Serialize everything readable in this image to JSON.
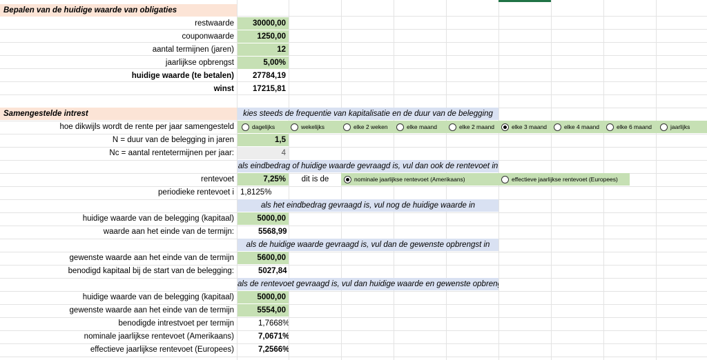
{
  "section1": {
    "title": "Bepalen van de huidige waarde van obligaties",
    "rows": [
      {
        "label": "restwaarde",
        "value": "30000,00"
      },
      {
        "label": "couponwaarde",
        "value": "1250,00"
      },
      {
        "label": "aantal termijnen (jaren)",
        "value": "12"
      },
      {
        "label": "jaarlijkse opbrengst",
        "value": "5,00%"
      },
      {
        "label": "huidige waarde (te betalen)",
        "value": "27784,19"
      },
      {
        "label": "winst",
        "value": "17215,81"
      }
    ]
  },
  "section2": {
    "title": "Samengestelde intrest",
    "banner1": "kies steeds de frequentie van kapitalisatie en de duur van de belegging",
    "freq_label": "hoe dikwijls wordt de rente per jaar samengesteld",
    "freq_options": [
      "dagelijks",
      "wekelijks",
      "elke 2 weken",
      "elke maand",
      "elke 2 maand",
      "elke 3 maand",
      "elke 4 maand",
      "elke 6 maand",
      "jaarlijks"
    ],
    "freq_selected": "elke 3 maand",
    "duur_label": "N = duur van de belegging in jaren",
    "duur_value": "1,5",
    "nc_label": "Nc = aantal rentetermijnen per jaar:",
    "nc_value": "4",
    "banner2": "als eindbedrag of huidige waarde gevraagd is, vul dan ook de rentevoet in",
    "rentevoet_label": "rentevoet",
    "rentevoet_value": "7,25%",
    "ditisde": "dit is de",
    "rate_options": [
      "nominale jaarlijkse rentevoet (Amerikaans)",
      "effectieve jaarlijkse rentevoet (Europees)"
    ],
    "rate_selected": "nominale jaarlijkse rentevoet (Amerikaans)",
    "periodiek_label": "periodieke rentevoet i",
    "periodiek_value": "1,8125%",
    "banner3": "als het eindbedrag gevraagd is, vul nog de huidige waarde in",
    "hw1_label": "huidige waarde van de belegging (kapitaal)",
    "hw1_value": "5000,00",
    "eind_label": "waarde aan het einde van de termijn:",
    "eind_value": "5568,99",
    "banner4": "als de huidige waarde gevraagd is, vul dan de gewenste opbrengst in",
    "gew1_label": "gewenste waarde aan het einde van de termijn",
    "gew1_value": "5600,00",
    "benodigd_label": "benodigd kapitaal bij de start van de belegging:",
    "benodigd_value": "5027,84",
    "banner5": "als de rentevoet gevraagd is, vul dan huidige waarde en gewenste opbrengst in",
    "hw2_label": "huidige waarde van de belegging (kapitaal)",
    "hw2_value": "5000,00",
    "gew2_label": "gewenste waarde aan het einde van de termijn",
    "gew2_value": "5554,00",
    "intrest_label": "benodigde intrestvoet per termijn",
    "intrest_value": "1,7668%",
    "nominaal_label": "nominale jaarlijkse rentevoet (Amerikaans)",
    "nominaal_value": "7,0671%",
    "effectief_label": "effectieve jaarlijkse rentevoet (Europees)",
    "effectief_value": "7,2566%"
  },
  "colors": {
    "input_green": "#c6e0b4",
    "banner_blue": "#d9e1f2",
    "header_peach": "#fce4d6"
  }
}
